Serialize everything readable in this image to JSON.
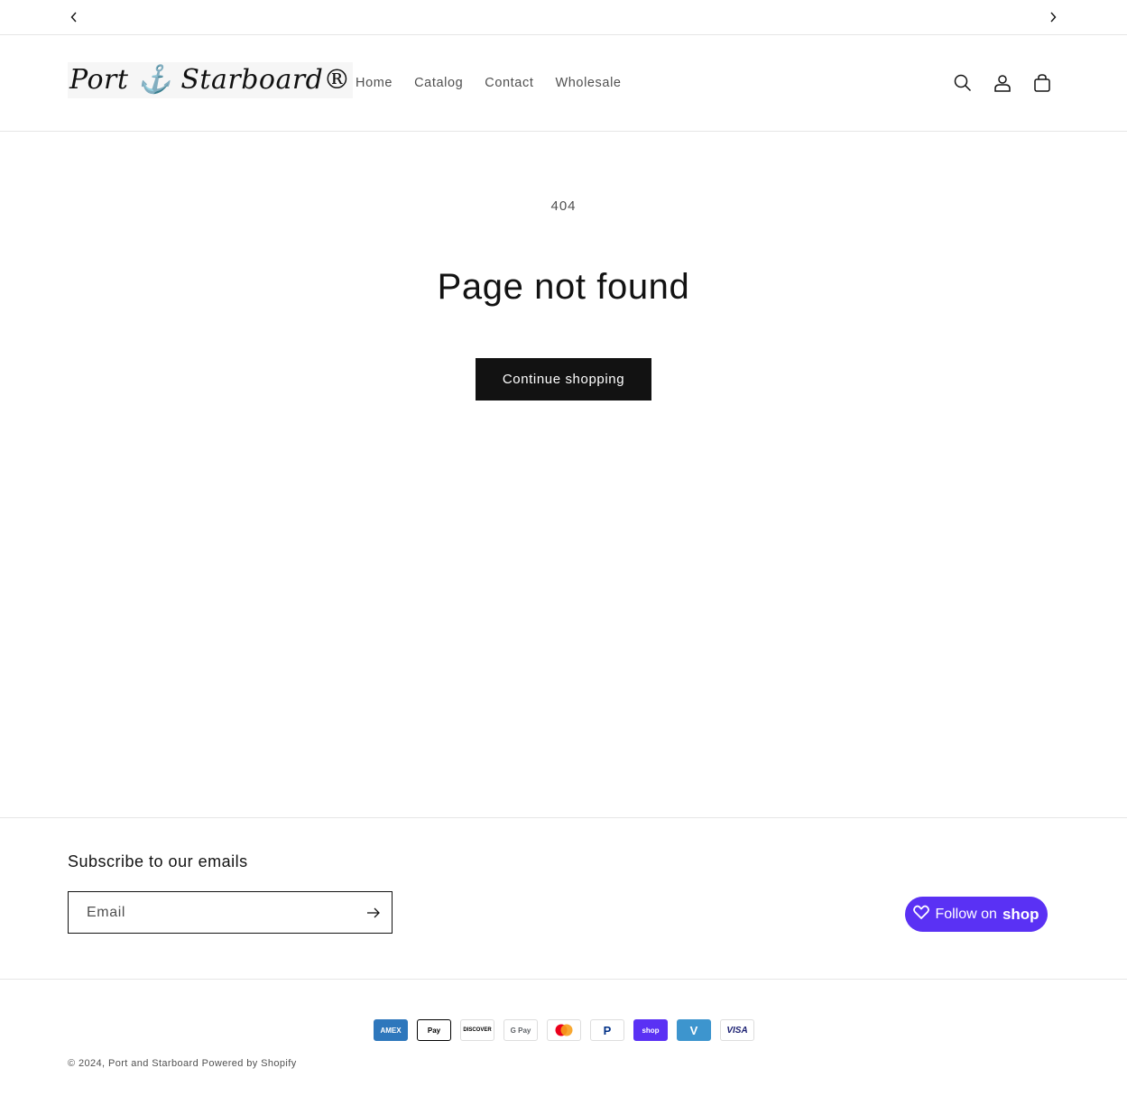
{
  "announcement": {
    "prev_icon": "chevron-left-icon",
    "next_icon": "chevron-right-icon"
  },
  "header": {
    "logo_text": "Port ⚓ Starboard®",
    "nav": [
      "Home",
      "Catalog",
      "Contact",
      "Wholesale"
    ],
    "icons": [
      "search-icon",
      "account-icon",
      "cart-icon"
    ]
  },
  "main": {
    "code": "404",
    "title": "Page not found",
    "cta_label": "Continue shopping"
  },
  "footer": {
    "subscribe_title": "Subscribe to our emails",
    "email_placeholder": "Email",
    "follow_prefix": "Follow on",
    "follow_brand": "shop",
    "payments": [
      "AMEX",
      "Pay",
      "DISCOVER",
      "G Pay",
      "Mastercard",
      "PayPal",
      "shop",
      "V",
      "VISA"
    ],
    "copyright_prefix": "© 2024,",
    "store_name": "Port and Starboard",
    "powered_by": "Powered by Shopify"
  },
  "colors": {
    "text": "#121212",
    "button_bg": "#121212",
    "shop_purple": "#5a31f4"
  }
}
